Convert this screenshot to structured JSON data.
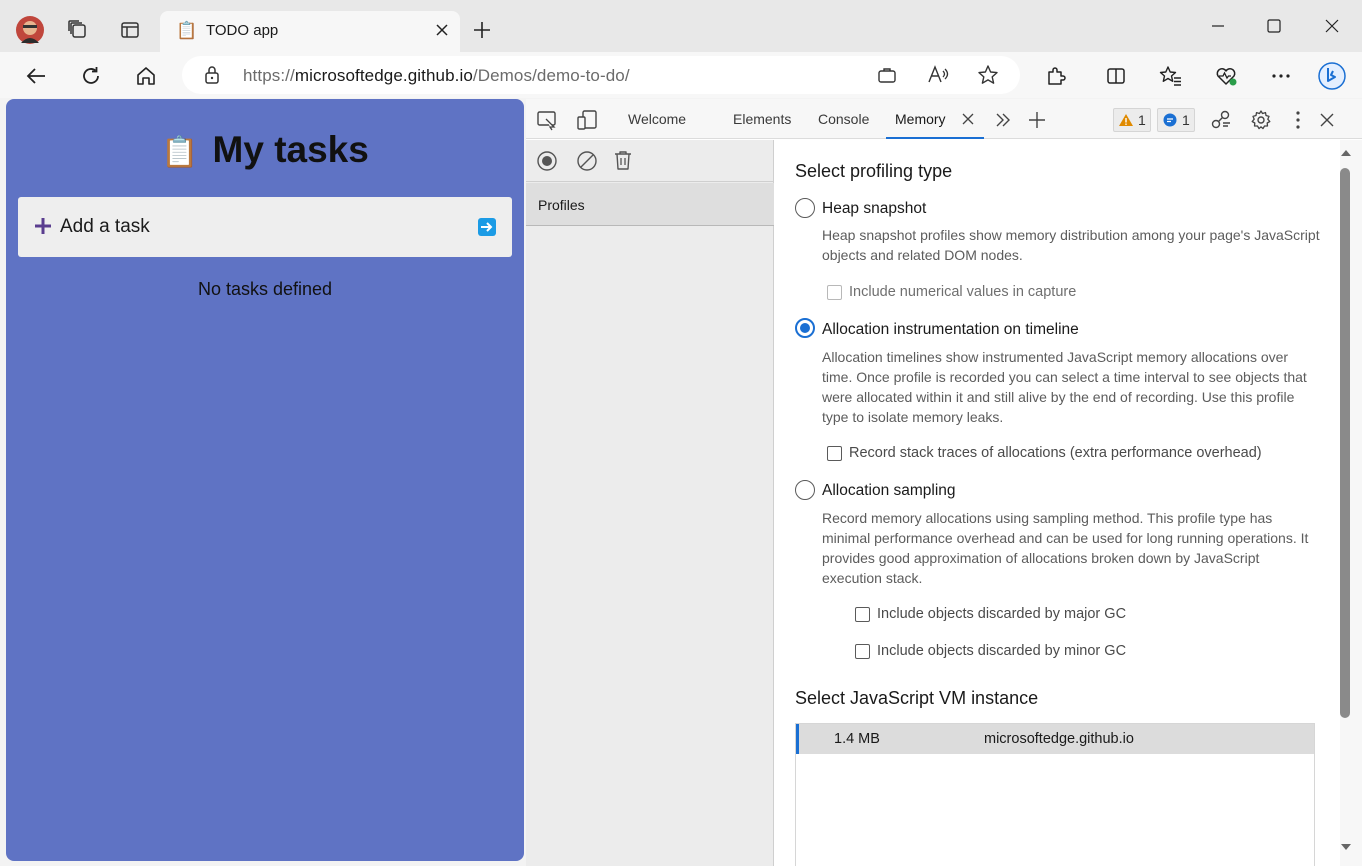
{
  "browser": {
    "tab": {
      "title": "TODO app",
      "favicon": "clipboard-icon"
    },
    "address": {
      "url_prefix": "https://",
      "url_host": "microsoftedge.github.io",
      "url_path": "/Demos/demo-to-do/"
    },
    "accent": "#1a6fd3"
  },
  "app": {
    "heading_icon": "📋",
    "heading": "My tasks",
    "add_task_label": "Add a task",
    "empty_message": "No tasks defined",
    "background_color": "#5f73c4"
  },
  "devtools": {
    "tabs": [
      {
        "label": "Welcome"
      },
      {
        "label": "Elements"
      },
      {
        "label": "Console"
      },
      {
        "label": "Memory",
        "selected": true
      }
    ],
    "warnings_count": "1",
    "messages_count": "1",
    "sidebar": {
      "profiles_label": "Profiles"
    },
    "profiling": {
      "title": "Select profiling type",
      "options": [
        {
          "label": "Heap snapshot",
          "selected": false,
          "description": "Heap snapshot profiles show memory distribution among your page's JavaScript objects and related DOM nodes.",
          "checkboxes": [
            {
              "label": "Include numerical values in capture",
              "checked": false,
              "disabled": true
            }
          ]
        },
        {
          "label": "Allocation instrumentation on timeline",
          "selected": true,
          "description": "Allocation timelines show instrumented JavaScript memory allocations over time. Once profile is recorded you can select a time interval to see objects that were allocated within it and still alive by the end of recording. Use this profile type to isolate memory leaks.",
          "checkboxes": [
            {
              "label": "Record stack traces of allocations (extra performance overhead)",
              "checked": false,
              "disabled": false
            }
          ]
        },
        {
          "label": "Allocation sampling",
          "selected": false,
          "description": "Record memory allocations using sampling method. This profile type has minimal performance overhead and can be used for long running operations. It provides good approximation of allocations broken down by JavaScript execution stack.",
          "checkboxes": [
            {
              "label": "Include objects discarded by major GC",
              "checked": false,
              "disabled": false
            },
            {
              "label": "Include objects discarded by minor GC",
              "checked": false,
              "disabled": false
            }
          ]
        }
      ]
    },
    "vm": {
      "title": "Select JavaScript VM instance",
      "instances": [
        {
          "size": "1.4 MB",
          "host": "microsoftedge.github.io",
          "selected": true
        }
      ]
    }
  }
}
